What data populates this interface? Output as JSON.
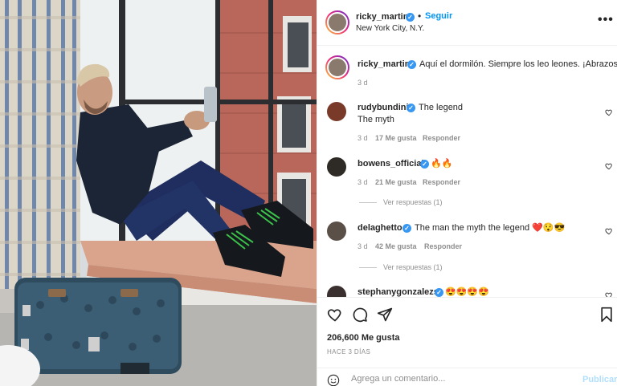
{
  "header": {
    "username": "ricky_martin",
    "verified_mark": "✓",
    "separator": "•",
    "follow_label": "Seguir",
    "location": "New York City, N.Y.",
    "more_label": "•••"
  },
  "caption": {
    "username": "ricky_martin",
    "text": "Aquí el dormilón. Siempre los leo leones. ¡Abrazos!",
    "time": "3 d"
  },
  "comments": [
    {
      "username": "rudybundini",
      "verified": true,
      "text": "The legend",
      "text2": "The myth",
      "time": "3 d",
      "likes": "17 Me gusta",
      "reply": "Responder",
      "avatar_color": "#7a3a2a"
    },
    {
      "username": "bowens_official",
      "verified": true,
      "text": "🔥🔥",
      "time": "3 d",
      "likes": "21 Me gusta",
      "reply": "Responder",
      "replies_label": "Ver respuestas (1)",
      "avatar_color": "#2e2a26"
    },
    {
      "username": "delaghetto",
      "verified": true,
      "text": "The man the myth the legend ❤️😯😎",
      "time": "3 d",
      "likes": "42 Me gusta",
      "reply": "Responder",
      "replies_label": "Ver respuestas (1)",
      "avatar_color": "#5a5048"
    },
    {
      "username": "stephanygonzalezs",
      "verified": true,
      "text": "😍😍😍😍",
      "avatar_color": "#3a3030"
    }
  ],
  "actions": {
    "like_icon": "heart-outline-icon",
    "comment_icon": "comment-icon",
    "share_icon": "paper-plane-icon",
    "save_icon": "bookmark-icon",
    "likes_text": "206,600 Me gusta",
    "date_text": "HACE 3 DÍAS"
  },
  "add_comment": {
    "emoji_icon": "smiley-icon",
    "placeholder": "Agrega un comentario...",
    "publish_label": "Publicar"
  },
  "colors": {
    "link_blue": "#0095f6",
    "verified_blue": "#3897f0",
    "publish_disabled": "#b2dffc",
    "muted_text": "#8e8e8e"
  }
}
